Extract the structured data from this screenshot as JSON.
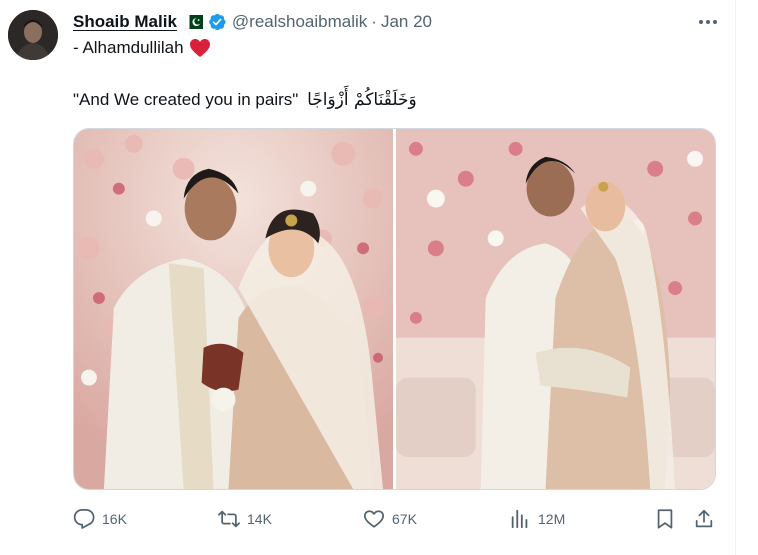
{
  "post": {
    "author_name": "Shoaib Malik",
    "handle": "@realshoaibmalik",
    "separator": "·",
    "date": "Jan 20",
    "text_line1": "- Alhamdullilah",
    "quote_english": "\"And We created you in pairs\"",
    "quote_arabic": "وَخَلَقْنَاكُمْ أَزْوَاجًا"
  },
  "icons": {
    "flag": "pakistan-flag-icon",
    "verified": "verified-badge-icon",
    "more": "more-options-icon",
    "heart_emoji": "red-heart-icon",
    "reply": "reply-icon",
    "repost": "repost-icon",
    "like": "like-icon",
    "views": "views-icon",
    "bookmark": "bookmark-icon",
    "share": "share-icon"
  },
  "media": {
    "count": 2
  },
  "metrics": {
    "replies": "16K",
    "reposts": "14K",
    "likes": "67K",
    "views": "12M"
  },
  "colors": {
    "text_primary": "#0f1419",
    "text_secondary": "#536471",
    "verified_blue": "#1d9bf0",
    "heart_red": "#d8223b",
    "flag_green": "#01411c"
  }
}
